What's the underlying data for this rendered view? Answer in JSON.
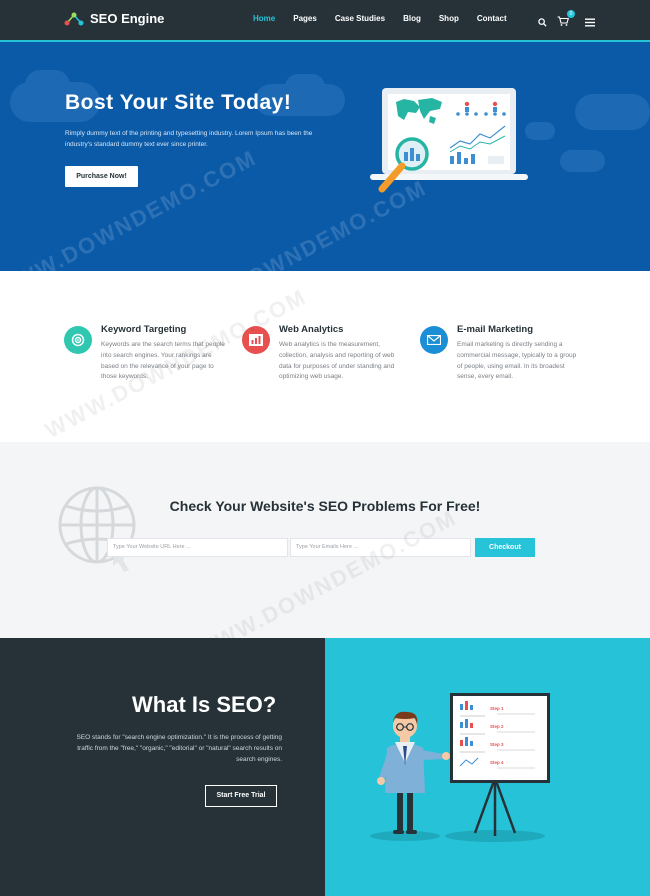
{
  "header": {
    "brand": "SEO Engine",
    "nav": [
      "Home",
      "Pages",
      "Case Studies",
      "Blog",
      "Shop",
      "Contact"
    ],
    "active_nav": "Home",
    "cart_count": "0",
    "icons": [
      "search-icon",
      "cart-icon",
      "menu-icon"
    ]
  },
  "hero": {
    "title": "Bost Your Site Today!",
    "text": "Rimply dummy text of the printing and typesetting industry. Lorem Ipsum has been the industry's standard dummy text ever since printer.",
    "button": "Purchase Now!",
    "watermark": "WWW.DOWNDEMO.COM"
  },
  "features": [
    {
      "title": "Keyword Targeting",
      "text": "Keywords are the search terms that people into search engines. Your rankings are based on the relevance of your page to those keywords.",
      "icon": "target-icon",
      "color": "#2fc7b0"
    },
    {
      "title": "Web Analytics",
      "text": "Web analytics is the measurement, collection, analysis and reporting of web data for purposes of under standing and optimizing web usage.",
      "icon": "bar-chart-icon",
      "color": "#e8504f"
    },
    {
      "title": "E-mail Marketing",
      "text": "Email marketing is directly sending a commercial message, typically to a group of people, using email. In its broadest sense, every email.",
      "icon": "envelope-icon",
      "color": "#1a8fd6"
    }
  ],
  "check": {
    "title": "Check Your Website's SEO Problems For Free!",
    "url_placeholder": "Type Your Website URL Here ...",
    "email_placeholder": "Type Your Emails Here ...",
    "button": "Checkout"
  },
  "seo": {
    "title": "What Is SEO?",
    "text": "SEO stands for \"search engine optimization.\" It is the process of getting traffic from the \"free,\" \"organic,\" \"editorial\" or \"natural\" search results on search engines.",
    "button": "Start Free Trial",
    "board_steps": [
      "Step 1",
      "Step 2",
      "Step 3",
      "Step 4"
    ]
  },
  "colors": {
    "accent": "#27c4d9",
    "dark": "#263238",
    "hero": "#0a5aa8"
  }
}
